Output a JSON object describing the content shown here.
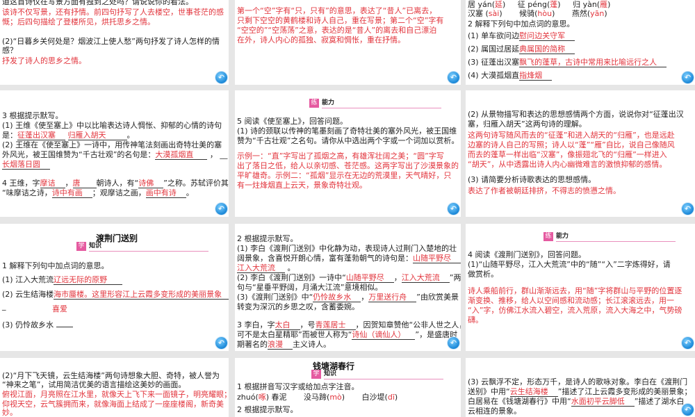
{
  "return_icon": "↶",
  "colors": {
    "answer": "#e2343c",
    "background": "#e6e6e6",
    "section_badge": "#e55aa0",
    "return_button": "#1a88d8"
  },
  "sections": {
    "ability": "能力",
    "knowledge": "知识",
    "ability_badge": "练",
    "knowledge_badge": "学"
  },
  "a": {
    "q1_cut": "道这首诗仅在写景方面有独到之处吗？请说说你的看法。",
    "ans1": [
      "该诗不仅写景，还有抒情。前四句抒写了人去楼空，世事苍茫的感",
      "慨；后四句描绘了登楼所见，烘托思乡之情。"
    ],
    "q2": [
      "(2)“日暮乡关何处是？烟波江上使人愁”两句抒发了诗人怎样的情",
      "感？"
    ],
    "ans2": "抒发了诗人的思乡之情。"
  },
  "b": {
    "ans": [
      "第一个“空”字有“只，只有”的意思，表达了“昔人”已离去，",
      "只剩下空空的黄鹤楼和诗人自己，重在写景；第二个“空”字有",
      "“空空的”“空荡荡”之意，表达的是“昔人”的离去和自己漂泊",
      "在外，诗人内心的孤独、寂寞和惆怅，重在抒情。"
    ]
  },
  "c": {
    "pinyin_cut": [
      "居 yán(",
      "延",
      ")",
      "征 péng(",
      "蓬",
      ")",
      "归 yàn(",
      "雁",
      ")"
    ],
    "pinyin": [
      "汉塞 (",
      "sài",
      ")",
      "候骑(",
      "hòu",
      ")",
      "燕然(",
      "yān",
      ")"
    ],
    "q2": "2 解释下列句中加点词的意思。",
    "items": [
      {
        "q": "(1) 单车欲问边",
        "a": "慰问边关守军"
      },
      {
        "q": "(2) 属国过居延",
        "a": "典属国的简称"
      },
      {
        "q": "(3) 征蓬出汉塞",
        "a": "飘飞的蓬草，古诗中常用来比喻远行之人"
      },
      {
        "q": "(4) 大漠孤烟直",
        "a": "指烽烟"
      }
    ]
  },
  "d": {
    "q3": "3 根据提示默写。",
    "q3_1": "(1) 王维《使至塞上》中以比喻表达诗人惆怅、抑郁的心情的诗句",
    "q3_1b": "是：",
    "a3_1": [
      "征蓬出汉塞",
      "归雁入胡天"
    ],
    "q3_2": [
      "(2) 王维在《使至塞上》一诗中，用传神笔法刻画出奇特壮美的塞",
      "外风光，被王国维赞为“千古壮观”的名句是："
    ],
    "a3_2": [
      "大漠孤烟直",
      "长烟落日圆"
    ],
    "q4_parts": [
      "4 王维，字",
      "，",
      "朝诗人，有“",
      "”之称。苏轼评价其：",
      "“味摩诘之诗，",
      "；观摩诘之画，",
      "。"
    ],
    "a4": [
      "摩诘",
      "唐",
      "诗佛",
      "诗中有画",
      "画中有诗"
    ]
  },
  "e": {
    "q5": "5 阅读《使至塞上》，回答问题。",
    "q5_1": [
      "(1) 诗的颈联以传神的笔墨刻画了奇特壮美的塞外风光，被王国维",
      "赞为“千古壮观”之名句。请你从中选出两个字或一个词加以赏析。"
    ],
    "ans": [
      "示例一：“直”字写出了孤烟之高，有雄浑壮阔之美；“圆”字写",
      "出了落日之低，给人以亲切感、苍茫感。这两字写出了沙漠景象的",
      "平旷雄奇。示例二：“孤烟”显示在无边的荒漠里，天气晴好，只",
      "有一炷烽烟直上云天，景象奇特壮观。"
    ]
  },
  "f": {
    "q2": [
      "(2) 从景物描写和表达的思想感情两个方面，说说你对“征蓬出汉",
      "塞，归雁入胡天”这两句诗的理解。"
    ],
    "ans2": [
      "这两句诗写随风而去的“征蓬”和进入胡天的“归雁”，也是远赴",
      "边塞的诗人自己的写照；诗人以“蓬”“雁”自比，说自己像随风",
      "而去的蓬草一样出临“汉塞”，像振翅北飞的“归雁”一样进入",
      "“胡天”，从中透露出诗人内心幽微难言的激愤抑郁的感情。"
    ],
    "q3": "(3) 请简要分析诗歌表达的思想感情。",
    "ans3": "表达了作者被朝廷排挤，不得志的愤懑之情。"
  },
  "g": {
    "title": "渡荆门送别",
    "q1": "1 解释下列句中加点词的意思。",
    "items": [
      {
        "q": "(1) 江入大荒流",
        "a": "辽远无际的原野"
      },
      {
        "q": "(2) 云生结海楼",
        "a": "海市蜃楼。这里形容江上云霞多变形成的美丽景象"
      },
      {
        "q": "(3) 仍怜故乡水",
        "a": "喜爱"
      }
    ]
  },
  "h": {
    "q2": "2 根据提示默写。",
    "q2_1": [
      "(1) 李白《渡荆门送别》中化静为动，表现诗人过荆门入楚地的壮",
      "阔景象，含喜悦开朗心情，富有蓬勃朝气的诗句是："
    ],
    "a2_1": [
      "山随平野尽",
      "江入大荒流"
    ],
    "q2_2": [
      "(2) 李白《渡荆门送别》一诗中“",
      "，",
      "”两",
      "句与“星垂平野阔，月涌大江流”意境相似。"
    ],
    "a2_2": [
      "山随平野尽",
      "江入大荒流"
    ],
    "q2_3": [
      "(3)《渡荆门送别》中“",
      "，",
      "”由欣赏美景",
      "转变为深沉的乡思之叹，含蓄委婉。"
    ],
    "a2_3": [
      "仍怜故乡水",
      "万里送行舟"
    ],
    "q3": [
      "3 李白，字",
      "，号",
      "，因贺知章赞他“公非人世之人，",
      "可不是太白星精耶”而被世人称为“",
      "”，是盛唐时",
      "期著名的",
      "主义诗人。"
    ],
    "a3": [
      "太白",
      "青莲居士",
      "诗仙（谪仙人）",
      "浪漫"
    ]
  },
  "i": {
    "q4": "4 阅读《渡荆门送别》，回答问题。",
    "q4_1": [
      "(1)“山随平野尽，江入大荒流”中的“随”“入”二字炼得好，请",
      "做赏析。"
    ],
    "ans": [
      "诗人乘船前行，群山渐渐远去，用“随”字将群山与平野的位置逐",
      "渐变换、推移，给人以空间感和流动感；长江滚滚远去，用一",
      "“入”字，仿佛江水流入碧空，流入荒原，流入大海之中，气势磅",
      "礴。"
    ]
  },
  "j": {
    "q2": [
      "(2)“月下飞天镜，云生结海楼”两句诗想象大胆、奇特，被人誉为",
      "“神来之笔”，试用简洁优美的语言描绘这美妙的画面。"
    ],
    "ans": [
      "俯视江面，月亮照在江水里，就像天上飞下来一面镜子，明亮耀眼；",
      "仰视天空，云气簇拥而来，就像海面上结成了一座座楼阁，新奇美",
      "妙。"
    ]
  },
  "k": {
    "title": "钱塘湖春行",
    "q1": "1 根据拼音写汉字或给加点字注音。",
    "parts": [
      "zhuó(",
      ") 春泥",
      "没马蹄(",
      ")",
      "白沙堤(",
      ")"
    ],
    "answers": [
      "啄",
      "mò",
      "dī"
    ],
    "q2_cut": "2 根据提示默写。"
  },
  "l": {
    "q3": [
      "(3) 云飘浮不定，形态万千，是诗人的歌咏对象。李白在《渡荆门",
      "送别》中用“",
      "”描述了江上云霞多变形成的美丽景象；",
      "白居易在《钱塘湖春行》中用“",
      "”描述了湖水白",
      "云相连的景象。"
    ],
    "answers": [
      "云生结海楼",
      "水面初平云脚低"
    ]
  }
}
